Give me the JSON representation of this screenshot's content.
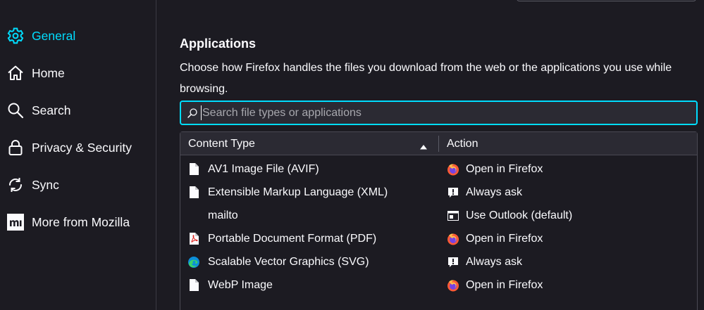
{
  "sidebar": {
    "items": [
      {
        "label": "General",
        "icon": "gear-icon",
        "selected": true
      },
      {
        "label": "Home",
        "icon": "home-icon"
      },
      {
        "label": "Search",
        "icon": "search-icon"
      },
      {
        "label": "Privacy & Security",
        "icon": "lock-icon"
      },
      {
        "label": "Sync",
        "icon": "sync-icon"
      },
      {
        "label": "More from Mozilla",
        "icon": "mozilla-icon"
      }
    ]
  },
  "applications": {
    "title": "Applications",
    "description": "Choose how Firefox handles the files you download from the web or the applications you use while browsing.",
    "search_placeholder": "Search file types or applications",
    "columns": {
      "content_type": "Content Type",
      "action": "Action"
    },
    "rows": [
      {
        "type": "AV1 Image File (AVIF)",
        "type_icon": "file-icon",
        "action": "Open in Firefox",
        "action_icon": "firefox-icon"
      },
      {
        "type": "Extensible Markup Language (XML)",
        "type_icon": "file-icon",
        "action": "Always ask",
        "action_icon": "ask-icon"
      },
      {
        "type": "mailto",
        "type_icon": "",
        "action": "Use Outlook (default)",
        "action_icon": "outlook-icon"
      },
      {
        "type": "Portable Document Format (PDF)",
        "type_icon": "pdf-icon",
        "action": "Open in Firefox",
        "action_icon": "firefox-icon"
      },
      {
        "type": "Scalable Vector Graphics (SVG)",
        "type_icon": "edge-icon",
        "action": "Always ask",
        "action_icon": "ask-icon"
      },
      {
        "type": "WebP Image",
        "type_icon": "file-icon",
        "action": "Open in Firefox",
        "action_icon": "firefox-icon"
      }
    ]
  },
  "colors": {
    "accent": "#00ddff",
    "background": "#1c1b22",
    "header": "#2b2a33"
  }
}
